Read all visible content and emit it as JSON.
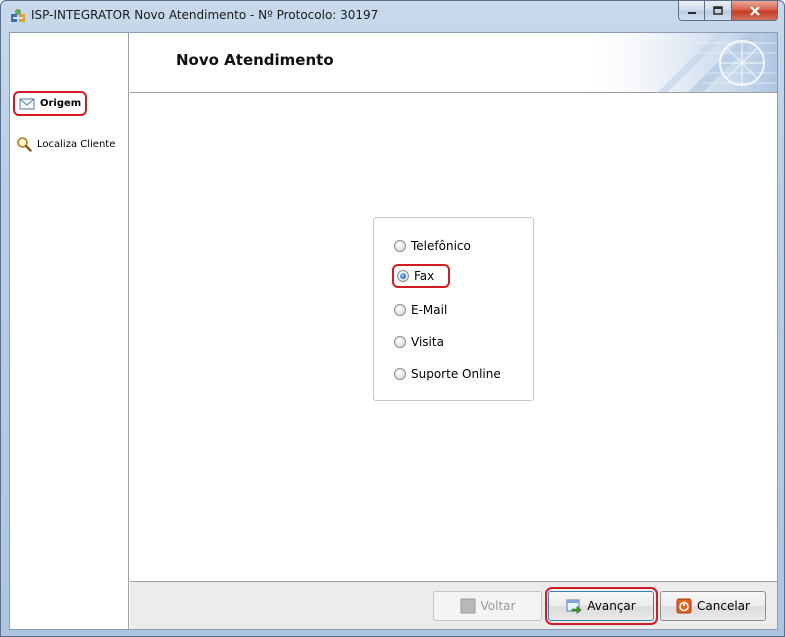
{
  "window": {
    "title": "ISP-INTEGRATOR Novo Atendimento - Nº Protocolo: 30197",
    "app_icon": "app-icon",
    "controls": {
      "minimize_icon": "minimize-icon",
      "maximize_icon": "maximize-icon",
      "close_icon": "close-icon"
    }
  },
  "sidebar": {
    "items": [
      {
        "label": "Origem",
        "icon": "envelope-icon",
        "active": true
      },
      {
        "label": "Localiza Cliente",
        "icon": "magnifier-icon",
        "active": false
      }
    ]
  },
  "header": {
    "title": "Novo Atendimento"
  },
  "origin_options": {
    "selected": "Fax",
    "options": [
      {
        "label": "Telefônico",
        "checked": false
      },
      {
        "label": "Fax",
        "checked": true
      },
      {
        "label": "E-Mail",
        "checked": false
      },
      {
        "label": "Visita",
        "checked": false
      },
      {
        "label": "Suporte Online",
        "checked": false
      }
    ]
  },
  "footer": {
    "back_label": "Voltar",
    "next_label": "Avançar",
    "cancel_label": "Cancelar"
  },
  "colors": {
    "highlight": "#d21b24",
    "radio_checked": "#1f6fb8",
    "titlebar": "#b9cde6"
  }
}
